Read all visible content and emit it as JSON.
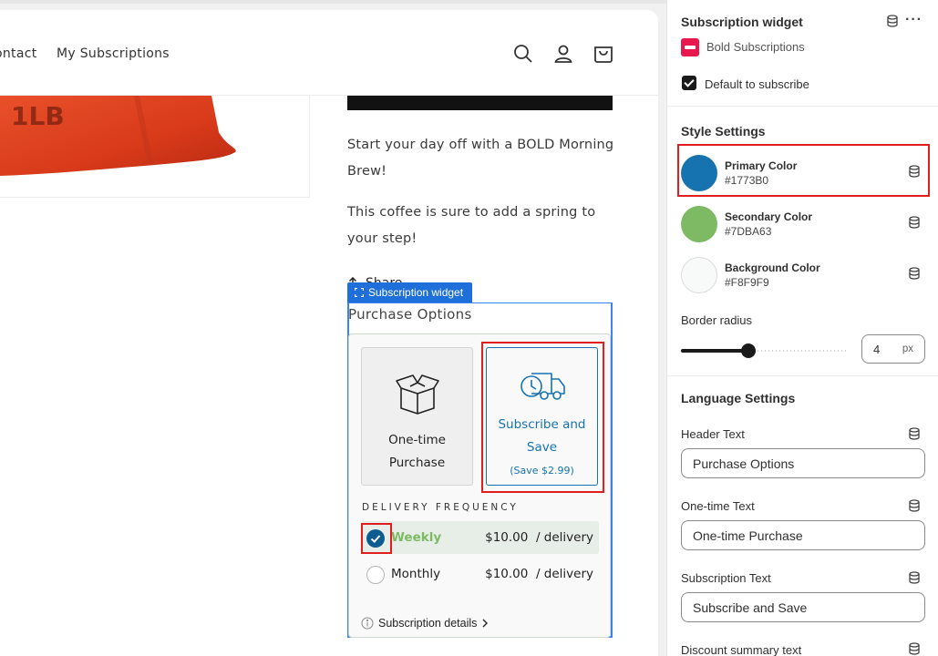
{
  "nav": {
    "contact": "ontact",
    "subscriptions": "My Subscriptions"
  },
  "header_icons": [
    "search-icon",
    "account-icon",
    "cart-icon"
  ],
  "product": {
    "bag_text": "1LB",
    "description_1": "Start your day off with a BOLD Morning Brew!",
    "description_2": "This coffee is sure to add a spring to your step!",
    "share_label": "Share"
  },
  "widget": {
    "tag_label": "Subscription widget",
    "title": "Purchase Options",
    "one_time_label": "One-time Purchase",
    "subscribe_label": "Subscribe and Save",
    "save_text": "(Save $2.99)",
    "frequency_label": "DELIVERY FREQUENCY",
    "frequencies": [
      {
        "name": "Weekly",
        "price": "$10.00  / delivery",
        "selected": true
      },
      {
        "name": "Monthly",
        "price": "$10.00  / delivery",
        "selected": false
      }
    ],
    "details_label": "Subscription details"
  },
  "panel": {
    "title": "Subscription widget",
    "app_name": "Bold Subscriptions",
    "default_subscribe_label": "Default to subscribe",
    "default_subscribe_checked": true,
    "style_title": "Style Settings",
    "colors": [
      {
        "name": "Primary Color",
        "hex": "#1773B0"
      },
      {
        "name": "Secondary Color",
        "hex": "#7DBA63"
      },
      {
        "name": "Background Color",
        "hex": "#F8F9F9"
      }
    ],
    "border_radius_label": "Border radius",
    "border_radius_value": "4",
    "border_radius_unit": "px",
    "language_title": "Language Settings",
    "fields": [
      {
        "label": "Header Text",
        "value": "Purchase Options"
      },
      {
        "label": "One-time Text",
        "value": "One-time Purchase"
      },
      {
        "label": "Subscription Text",
        "value": "Subscribe and Save"
      },
      {
        "label": "Discount summary text",
        "value": ""
      }
    ]
  },
  "accent_colors": {
    "primary": "#1773B0",
    "secondary": "#7DBA63",
    "highlight": "#e11d1d",
    "editor_blue": "#1e6fd9"
  }
}
